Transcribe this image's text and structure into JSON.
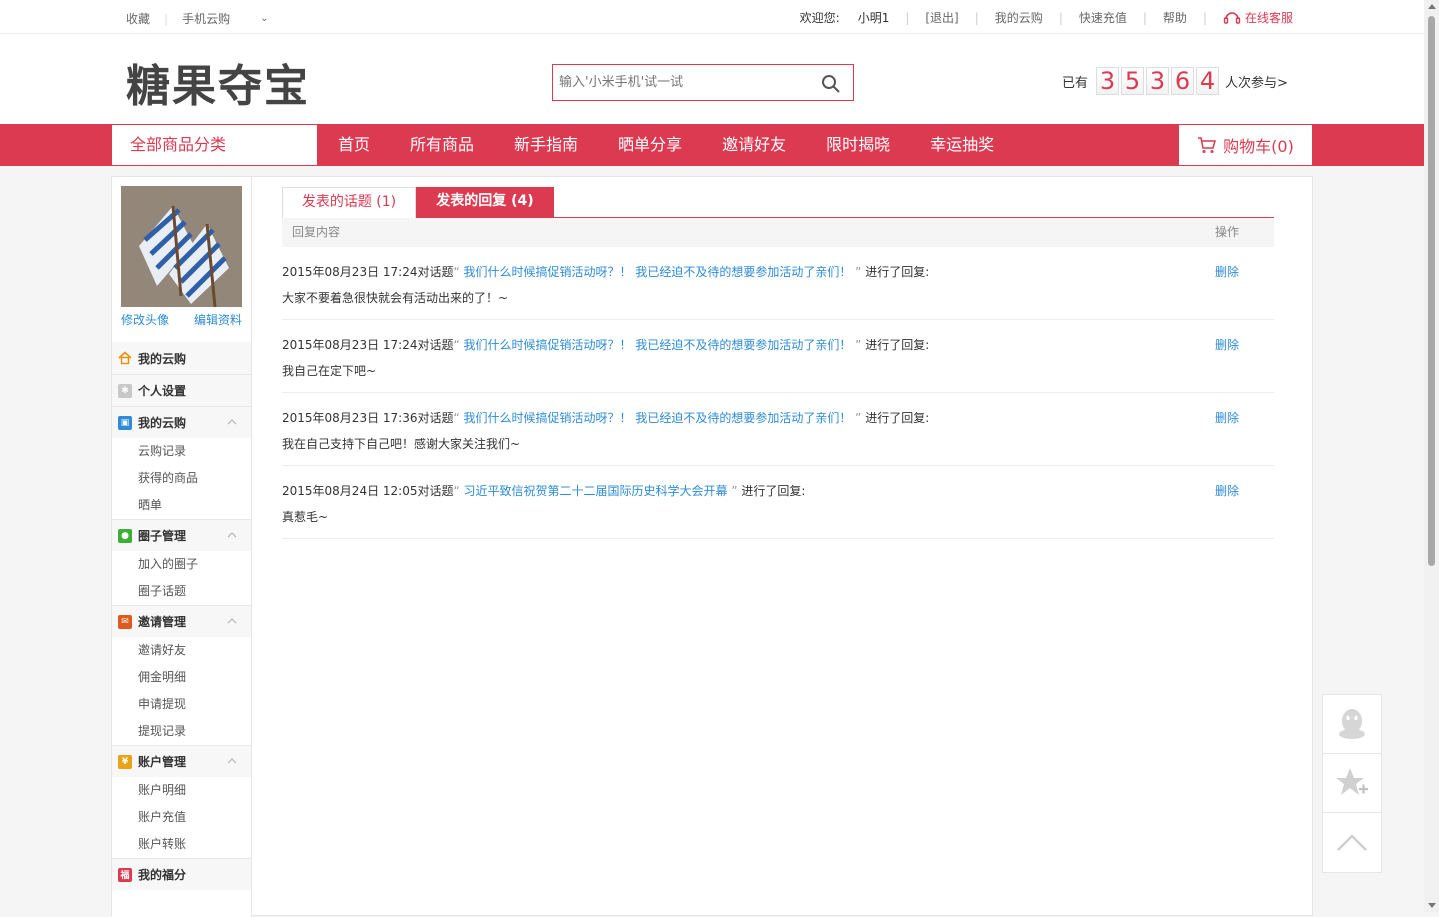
{
  "topbar": {
    "favorites": "收藏",
    "mobile": "手机云购",
    "welcome": "欢迎您:",
    "username": "小明1",
    "logout": "[退出]",
    "my_yungou": "我的云购",
    "recharge": "快速充值",
    "help": "帮助",
    "service": "在线客服"
  },
  "header": {
    "logo": "糖果夺宝",
    "search_placeholder": "输入'小米手机'试一试",
    "counter_prefix": "已有",
    "counter_digits": [
      "3",
      "5",
      "3",
      "6",
      "4"
    ],
    "counter_suffix": "人次参与>"
  },
  "nav": {
    "category": "全部商品分类",
    "links": [
      "首页",
      "所有商品",
      "新手指南",
      "晒单分享",
      "邀请好友",
      "限时揭晓",
      "幸运抽奖"
    ],
    "cart": "购物车(0)"
  },
  "sidebar": {
    "change_avatar": "修改头像",
    "edit_profile": "编辑资料",
    "groups": [
      {
        "label": "我的云购",
        "icon": "home-icon",
        "color": "#f08c00",
        "items": []
      },
      {
        "label": "个人设置",
        "icon": "settings-icon",
        "color": "#bbbbbb",
        "items": []
      },
      {
        "label": "我的云购",
        "icon": "cart-icon",
        "color": "#2d8bd8",
        "items": [
          "云购记录",
          "获得的商品",
          "晒单"
        ]
      },
      {
        "label": "圈子管理",
        "icon": "circle-icon",
        "color": "#3cb034",
        "items": [
          "加入的圈子",
          "圈子话题"
        ]
      },
      {
        "label": "邀请管理",
        "icon": "invite-icon",
        "color": "#e05a1e",
        "items": [
          "邀请好友",
          "佣金明细",
          "申请提现",
          "提现记录"
        ]
      },
      {
        "label": "账户管理",
        "icon": "yen-icon",
        "color": "#e8a317",
        "items": [
          "账户明细",
          "账户充值",
          "账户转账"
        ]
      },
      {
        "label": "我的福分",
        "icon": "fortune-icon",
        "color": "#dc3a50",
        "items": []
      }
    ]
  },
  "tabs": {
    "topics": "发表的话题 (1)",
    "replies": "发表的回复 (4)"
  },
  "table": {
    "col_content": "回复内容",
    "col_action": "操作",
    "rows": [
      {
        "time": "2015年08月23日 17:24",
        "prefix": "对话题",
        "topic": "我们什么时候搞促销活动呀？！ 我已经迫不及待的想要参加活动了亲们！",
        "suffix": "进行了回复:",
        "reply": "大家不要着急很快就会有活动出来的了！~",
        "action": "删除"
      },
      {
        "time": "2015年08月23日 17:24",
        "prefix": "对话题",
        "topic": "我们什么时候搞促销活动呀？！ 我已经迫不及待的想要参加活动了亲们！",
        "suffix": "进行了回复:",
        "reply": "我自己在定下吧~",
        "action": "删除"
      },
      {
        "time": "2015年08月23日 17:36",
        "prefix": "对话题",
        "topic": "我们什么时候搞促销活动呀？！ 我已经迫不及待的想要参加活动了亲们！",
        "suffix": "进行了回复:",
        "reply": "我在自己支持下自己吧！感谢大家关注我们~",
        "action": "删除"
      },
      {
        "time": "2015年08月24日 12:05",
        "prefix": "对话题",
        "topic": "习近平致信祝贺第二十二届国际历史科学大会开幕",
        "suffix": "进行了回复:",
        "reply": "真惹毛~",
        "action": "删除"
      }
    ]
  },
  "colors": {
    "accent": "#dc3a50",
    "link": "#2d8bd8"
  }
}
